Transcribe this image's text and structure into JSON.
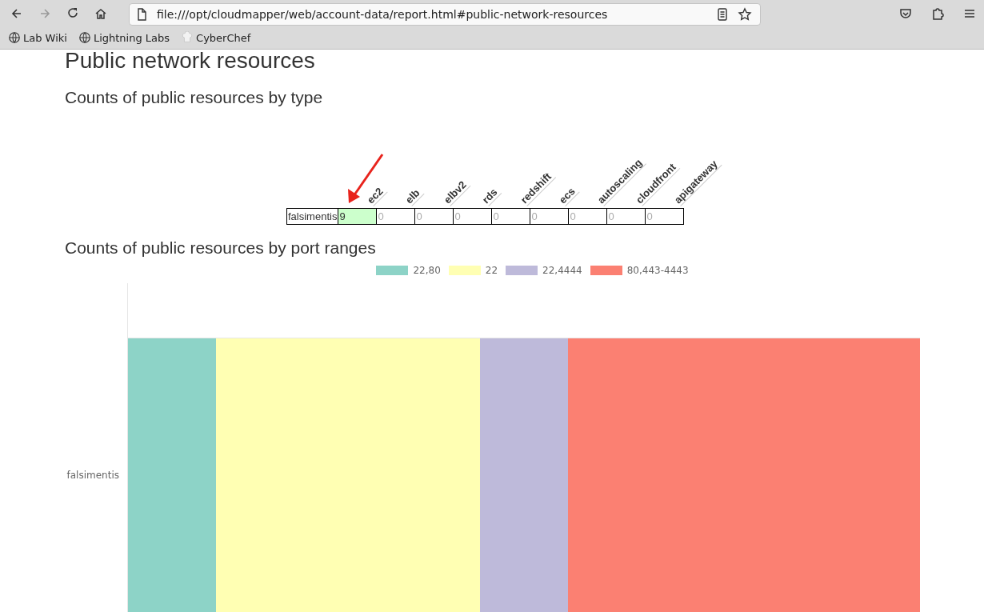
{
  "browser": {
    "url": "file:///opt/cloudmapper/web/account-data/report.html#public-network-resources",
    "bookmarks": [
      {
        "label": "Lab Wiki",
        "kind": "globe"
      },
      {
        "label": "Lightning Labs",
        "kind": "globe"
      },
      {
        "label": "CyberChef",
        "kind": "chef"
      }
    ]
  },
  "page": {
    "title": "Public network resources"
  },
  "type_section": {
    "heading": "Counts of public resources by type",
    "table": {
      "columns": [
        "ec2",
        "elb",
        "elbv2",
        "rds",
        "redshift",
        "ecs",
        "autoscaling",
        "cloudfront",
        "apigateway"
      ],
      "rows": [
        {
          "account": "falsimentis",
          "cells": [
            {
              "value": "9",
              "highlighted": true
            },
            {
              "value": "0",
              "highlighted": false
            },
            {
              "value": "0",
              "highlighted": false
            },
            {
              "value": "0",
              "highlighted": false
            },
            {
              "value": "0",
              "highlighted": false
            },
            {
              "value": "0",
              "highlighted": false
            },
            {
              "value": "0",
              "highlighted": false
            },
            {
              "value": "0",
              "highlighted": false
            },
            {
              "value": "0",
              "highlighted": false
            }
          ]
        }
      ]
    }
  },
  "port_section": {
    "heading": "Counts of public resources by port ranges",
    "legend": [
      {
        "label": "22,80",
        "color": "#8dd3c7"
      },
      {
        "label": "22",
        "color": "#ffffb3"
      },
      {
        "label": "22,4444",
        "color": "#bebada"
      },
      {
        "label": "80,443-4443",
        "color": "#fb8072"
      }
    ],
    "rows": [
      {
        "label": "falsimentis"
      }
    ]
  }
}
